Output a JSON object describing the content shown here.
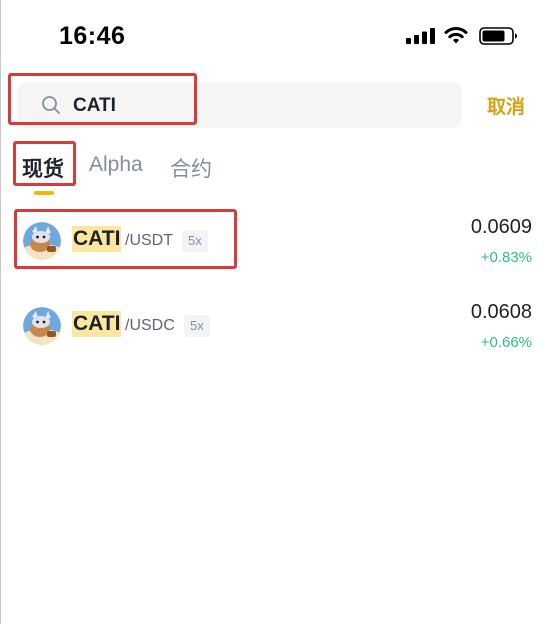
{
  "status_bar": {
    "time": "16:46"
  },
  "search": {
    "value": "CATI",
    "cancel_label": "取消"
  },
  "tabs": [
    {
      "label": "现货",
      "active": true
    },
    {
      "label": "Alpha",
      "active": false
    },
    {
      "label": "合约",
      "active": false
    }
  ],
  "results": [
    {
      "base": "CATI",
      "quote": "/USDT",
      "leverage": "5x",
      "price": "0.0609",
      "change": "+0.83%"
    },
    {
      "base": "CATI",
      "quote": "/USDC",
      "leverage": "5x",
      "price": "0.0608",
      "change": "+0.66%"
    }
  ],
  "colors": {
    "accent": "#f0b90b",
    "cancel": "#d9a012",
    "up": "#2ebd85",
    "highlight": "#fbe7a0",
    "annotation": "#d93a3a"
  }
}
